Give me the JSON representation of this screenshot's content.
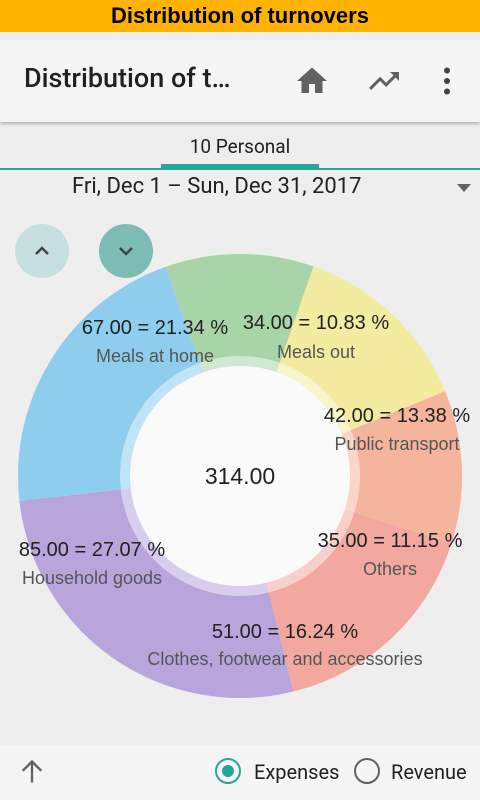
{
  "banner": {
    "title": "Distribution of turnovers"
  },
  "toolbar": {
    "title": "Distribution of t…",
    "icons": [
      "home-icon",
      "trending-up-icon",
      "more-vert-icon"
    ]
  },
  "tab": {
    "label": "10 Personal"
  },
  "period": {
    "label": "Fri, Dec 1 – Sun, Dec 31, 2017"
  },
  "bottom": {
    "expenses_label": "Expenses",
    "revenue_label": "Revenue",
    "selected": "Expenses"
  },
  "colors": {
    "accent": "#26a69a"
  },
  "chart_data": {
    "type": "pie",
    "total": "314.00",
    "slices": [
      {
        "category": "Meals out",
        "amount": 34.0,
        "percent": 10.83,
        "label": "34.00 = 10.83 %",
        "color": "#a8d5a8"
      },
      {
        "category": "Public transport",
        "amount": 42.0,
        "percent": 13.38,
        "label": "42.00 = 13.38 %",
        "color": "#f3eba0"
      },
      {
        "category": "Others",
        "amount": 35.0,
        "percent": 11.15,
        "label": "35.00 = 11.15 %",
        "color": "#f4b59c"
      },
      {
        "category": "Clothes, footwear and accessories",
        "amount": 51.0,
        "percent": 16.24,
        "label": "51.00 = 16.24 %",
        "color": "#f2a89f"
      },
      {
        "category": "Household goods",
        "amount": 85.0,
        "percent": 27.07,
        "label": "85.00 = 27.07 %",
        "color": "#b7a5dc"
      },
      {
        "category": "Meals at home",
        "amount": 67.0,
        "percent": 21.34,
        "label": "67.00 = 21.34 %",
        "color": "#8fcdef"
      }
    ]
  }
}
